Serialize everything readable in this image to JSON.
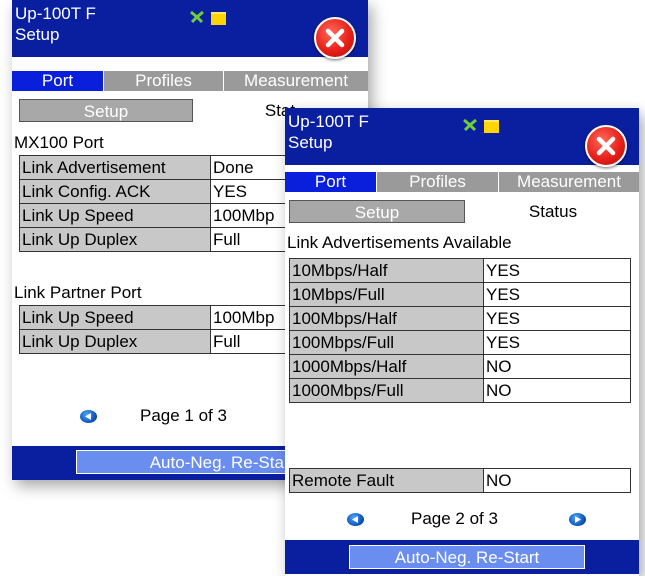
{
  "window_back": {
    "title_line1": "Up-100T F",
    "title_line2": "Setup",
    "tabs": [
      "Port",
      "Profiles",
      "Measurement"
    ],
    "subtabs": [
      "Setup",
      "Stat"
    ],
    "section1": "MX100 Port",
    "rows1": [
      {
        "label": "Link Advertisement",
        "value": "Done"
      },
      {
        "label": "Link Config. ACK",
        "value": "YES"
      },
      {
        "label": "Link Up Speed",
        "value": "100Mbp"
      },
      {
        "label": "Link Up Duplex",
        "value": "Full"
      }
    ],
    "section2": "Link Partner Port",
    "rows2": [
      {
        "label": "Link Up Speed",
        "value": "100Mbp"
      },
      {
        "label": "Link Up Duplex",
        "value": "Full"
      }
    ],
    "page_text": "Page 1 of 3",
    "button": "Auto-Neg. Re-Start"
  },
  "window_front": {
    "title_line1": "Up-100T F",
    "title_line2": "Setup",
    "tabs": [
      "Port",
      "Profiles",
      "Measurement"
    ],
    "subtabs": [
      "Setup",
      "Status"
    ],
    "section1": "Link Advertisements Available",
    "rows1": [
      {
        "label": "10Mbps/Half",
        "value": "YES"
      },
      {
        "label": "10Mbps/Full",
        "value": "YES"
      },
      {
        "label": "100Mbps/Half",
        "value": "YES"
      },
      {
        "label": "100Mbps/Full",
        "value": "YES"
      },
      {
        "label": "1000Mbps/Half",
        "value": "NO"
      },
      {
        "label": "1000Mbps/Full",
        "value": "NO"
      }
    ],
    "rows2": [
      {
        "label": "Remote Fault",
        "value": "NO"
      }
    ],
    "page_text": "Page 2 of 3",
    "button": "Auto-Neg. Re-Start"
  },
  "icons": {
    "status": [
      "network-icon",
      "folder-icon"
    ],
    "close": "close-icon",
    "prev": "prev-page-icon",
    "next": "next-page-icon"
  },
  "colors": {
    "titlebar": "#0a1fa0",
    "active_tab": "#0a1fdc",
    "inactive_tab": "#9a9a9a",
    "label_cell": "#c8c8c8",
    "button": "#6a8ef0",
    "close": "#e8201a"
  }
}
